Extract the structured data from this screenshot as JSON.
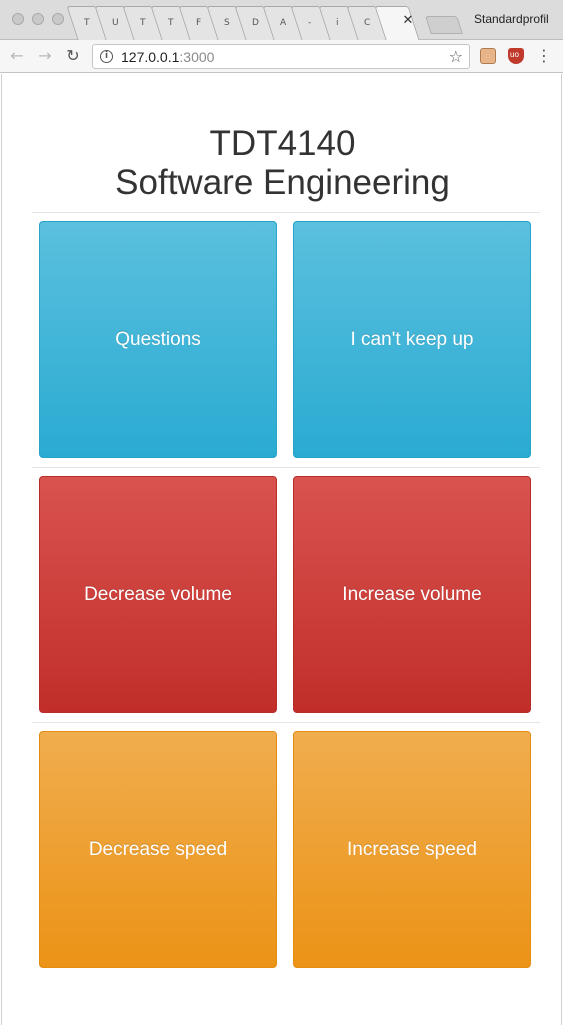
{
  "browser": {
    "profile_name": "Standardprofil",
    "tab_favicons": [
      "T",
      "U",
      "T",
      "T",
      "F",
      "S",
      "D",
      "A",
      "-",
      "i",
      "C"
    ],
    "tab_close_glyph": "✕",
    "address": {
      "host": "127.0.0.1",
      "port": ":3000"
    },
    "icons": {
      "back": "←",
      "forward": "→",
      "reload": "↻",
      "info": "i",
      "star": "☆",
      "menu": "⋮"
    }
  },
  "page": {
    "title_line1": "TDT4140",
    "title_line2": "Software Engineering",
    "buttons": {
      "questions": "Questions",
      "cant_keep_up": "I can't keep up",
      "decrease_volume": "Decrease volume",
      "increase_volume": "Increase volume",
      "decrease_speed": "Decrease speed",
      "increase_speed": "Increase speed"
    },
    "colors": {
      "info": "#5bc0de",
      "danger": "#d9534f",
      "warning": "#f0ad4e",
      "title_text": "#333333"
    }
  }
}
